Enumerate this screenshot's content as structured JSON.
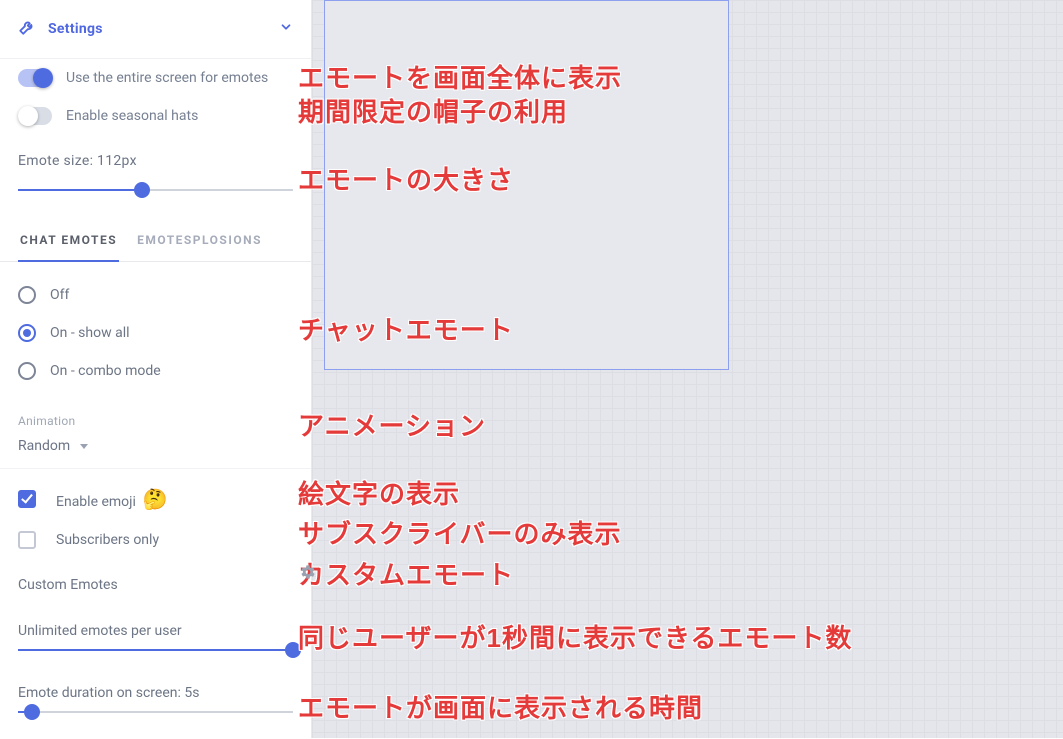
{
  "header": {
    "title": "Settings"
  },
  "toggles": {
    "entire_screen": {
      "label": "Use the entire screen for emotes",
      "on": true
    },
    "seasonal_hats": {
      "label": "Enable seasonal hats",
      "on": false
    }
  },
  "emote_size": {
    "label": "Emote size: 112px",
    "value_pct": 45
  },
  "tabs": {
    "chat_emotes": "CHAT EMOTES",
    "emotesplosions": "EMOTESPLOSIONS",
    "active": "chat_emotes"
  },
  "radios": {
    "off": "Off",
    "show_all": "On - show all",
    "combo": "On - combo mode",
    "selected": "show_all"
  },
  "animation": {
    "heading": "Animation",
    "value": "Random"
  },
  "checks": {
    "enable_emoji": {
      "label": "Enable emoji",
      "emoji": "🤔",
      "checked": true
    },
    "subs_only": {
      "label": "Subscribers only",
      "checked": false
    }
  },
  "custom_emotes_label": "Custom Emotes",
  "sliders": {
    "per_user": {
      "label": "Unlimited emotes per user",
      "value_pct": 100
    },
    "duration": {
      "label": "Emote duration on screen: 5s",
      "value_pct": 5
    }
  },
  "annotations": {
    "a1": "エモートを画面全体に表示",
    "a2": "期間限定の帽子の利用",
    "a3": "エモートの大きさ",
    "a4": "チャットエモート",
    "a5": "アニメーション",
    "a6": "絵文字の表示",
    "a7": "サブスクライバーのみ表示",
    "a8": "カスタムエモート",
    "a9": "同じユーザーが1秒間に表示できるエモート数",
    "a10": "エモートが画面に表示される時間"
  }
}
